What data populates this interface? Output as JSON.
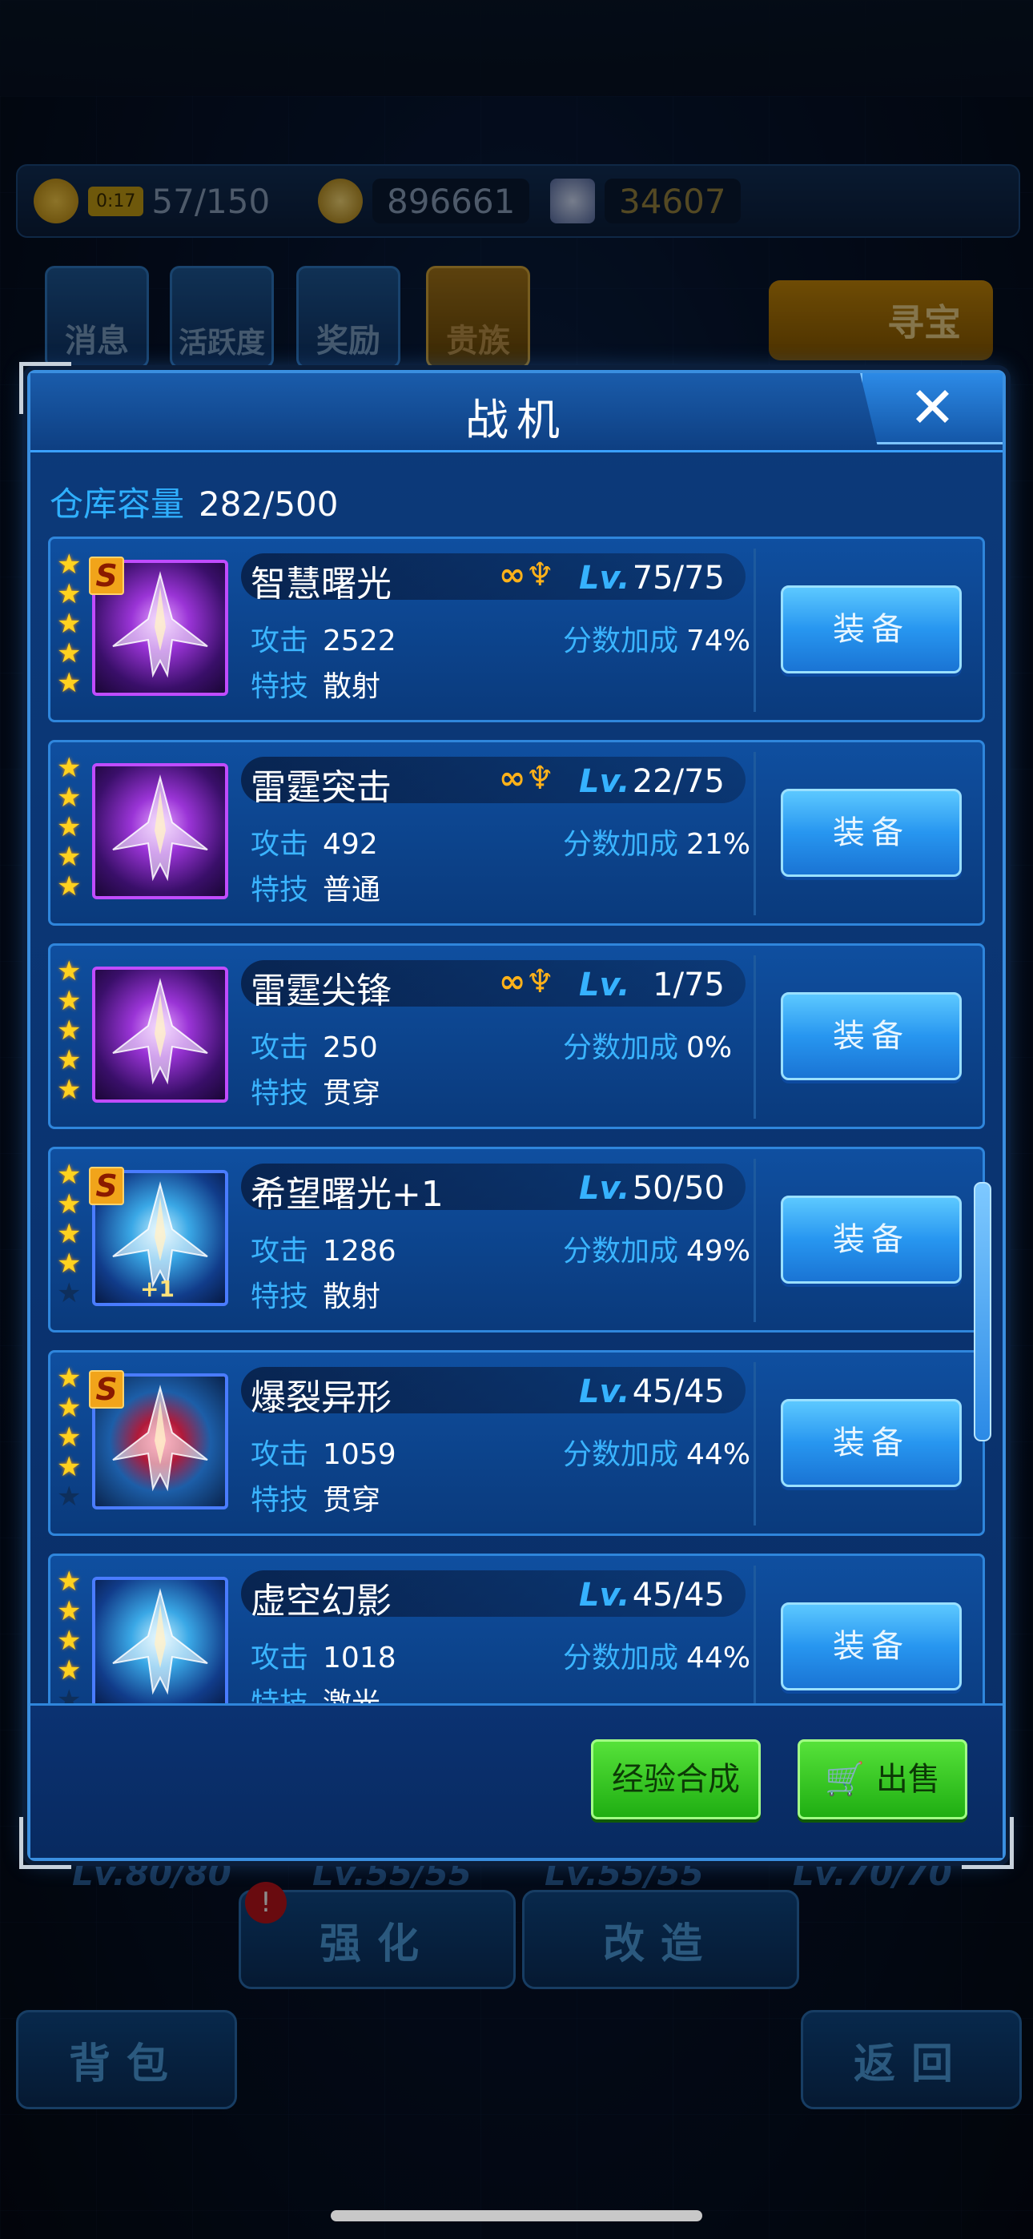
{
  "resources": {
    "energy_timer": "0:17",
    "energy": "57/150",
    "coins": "896661",
    "gems": "34607"
  },
  "top_buttons": [
    {
      "label": "消息"
    },
    {
      "label": "活跃度"
    },
    {
      "label": "奖励"
    },
    {
      "label": "贵族"
    }
  ],
  "treasure_label": "寻宝",
  "modal": {
    "title": "战机",
    "close_glyph": "✕",
    "capacity_label": "仓库容量",
    "capacity_value": "282/500",
    "equip_label": "装备",
    "attack_label": "攻击",
    "skill_label": "特技",
    "bonus_label": "分数加成",
    "lv_label": "Lv.",
    "planes": [
      {
        "name": "智慧曙光",
        "level": "75/75",
        "attack": "2522",
        "bonus": "74%",
        "skill": "散射",
        "stars": 5,
        "s_rank": true,
        "linked": true,
        "plus": "",
        "style": "purple"
      },
      {
        "name": "雷霆突击",
        "level": "22/75",
        "attack": "492",
        "bonus": "21%",
        "skill": "普通",
        "stars": 5,
        "s_rank": false,
        "linked": true,
        "plus": "",
        "style": "purple"
      },
      {
        "name": "雷霆尖锋",
        "level": "1/75",
        "attack": "250",
        "bonus": "0%",
        "skill": "贯穿",
        "stars": 5,
        "s_rank": false,
        "linked": true,
        "plus": "",
        "style": "purple"
      },
      {
        "name": "希望曙光+1",
        "level": "50/50",
        "attack": "1286",
        "bonus": "49%",
        "skill": "散射",
        "stars": 4,
        "s_rank": true,
        "linked": false,
        "plus": "+1",
        "style": "blue"
      },
      {
        "name": "爆裂异形",
        "level": "45/45",
        "attack": "1059",
        "bonus": "44%",
        "skill": "贯穿",
        "stars": 4,
        "s_rank": true,
        "linked": false,
        "plus": "",
        "style": "red"
      },
      {
        "name": "虚空幻影",
        "level": "45/45",
        "attack": "1018",
        "bonus": "44%",
        "skill": "激光",
        "stars": 4,
        "s_rank": false,
        "linked": false,
        "plus": "",
        "style": "blue"
      }
    ],
    "exp_button": "经验合成",
    "sell_button": "出售"
  },
  "bottom_nav": {
    "enhance": "强化",
    "modify": "改造",
    "bag": "背包",
    "back": "返回",
    "levels": [
      "Lv.80/80",
      "Lv.55/55",
      "Lv.55/55",
      "Lv.70/70"
    ],
    "badge": "!"
  },
  "colors": {
    "accent": "#36b2ff",
    "star": "#ffd21f",
    "equip_button": "#2796f0",
    "green_button": "#1fae12"
  }
}
